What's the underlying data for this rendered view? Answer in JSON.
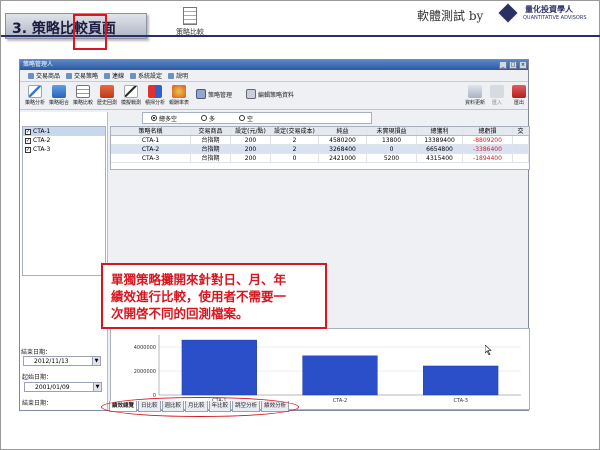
{
  "slide": {
    "title": "3. 策略比較頁面",
    "top_icon_label": "策略比較",
    "tester": "軟體測試 by",
    "logo": {
      "cn": "量化投資學人",
      "en": "QUANTITATIVE ADVISORS"
    }
  },
  "window": {
    "title": "策略管理人",
    "controls": [
      "_",
      "□",
      "×"
    ],
    "menu": [
      "交易商品",
      "交易策略",
      "連線",
      "系統設定",
      "說明"
    ],
    "toolbar": [
      "策略分析",
      "策略組合",
      "策略比較",
      "歷史回測",
      "模擬戰測",
      "積掃分析",
      "報酬率表"
    ],
    "toolbar_wide": [
      "策略管理",
      "編輯策略資料"
    ],
    "toolbar_right": [
      "資料更新",
      "匯入",
      "匯出"
    ]
  },
  "left": {
    "strategies": [
      {
        "name": "CTA-1",
        "checked": true
      },
      {
        "name": "CTA-2",
        "checked": true
      },
      {
        "name": "CTA-3",
        "checked": true
      }
    ],
    "start_label": "起始日期：",
    "start_date": "2001/01/09",
    "end_label": "結束日期：",
    "end_date": "2012/11/13"
  },
  "radios": [
    "總多空",
    "多",
    "空"
  ],
  "table": {
    "headers": [
      "策略名稱",
      "交易商品",
      "設定(元/點)",
      "設定(交易成本)",
      "純益",
      "未實現損益",
      "總獲利",
      "總虧損",
      "交"
    ],
    "rows": [
      [
        "CTA-1",
        "台指期",
        "200",
        "2",
        "4580200",
        "13800",
        "13389400",
        "-8809200"
      ],
      [
        "CTA-2",
        "台指期",
        "200",
        "2",
        "3268400",
        "0",
        "6654800",
        "-3386400"
      ],
      [
        "CTA-3",
        "台指期",
        "200",
        "0",
        "2421000",
        "5200",
        "4315400",
        "-1894400"
      ]
    ]
  },
  "callout": [
    "單獨策略攤開來針對日、月、年",
    "績效進行比較，使用者不需要一",
    "次開啓不同的回測檔案。"
  ],
  "chart_data": {
    "type": "bar",
    "categories": [
      "CTA-1",
      "CTA-2",
      "CTA-3"
    ],
    "values": [
      4580200,
      3268400,
      2421000
    ],
    "title": "",
    "xlabel": "",
    "ylabel": "",
    "ylim": [
      0,
      5000000
    ],
    "yticks": [
      0,
      2000000,
      4000000
    ],
    "ytick_labels": [
      "0",
      "2000000",
      "4000000"
    ],
    "bar_color": "#2a4fc8",
    "grid": true
  },
  "tabs": [
    "績效總覽",
    "日比較",
    "週比較",
    "月比較",
    "年比較",
    "跳空分析",
    "績效分析"
  ]
}
